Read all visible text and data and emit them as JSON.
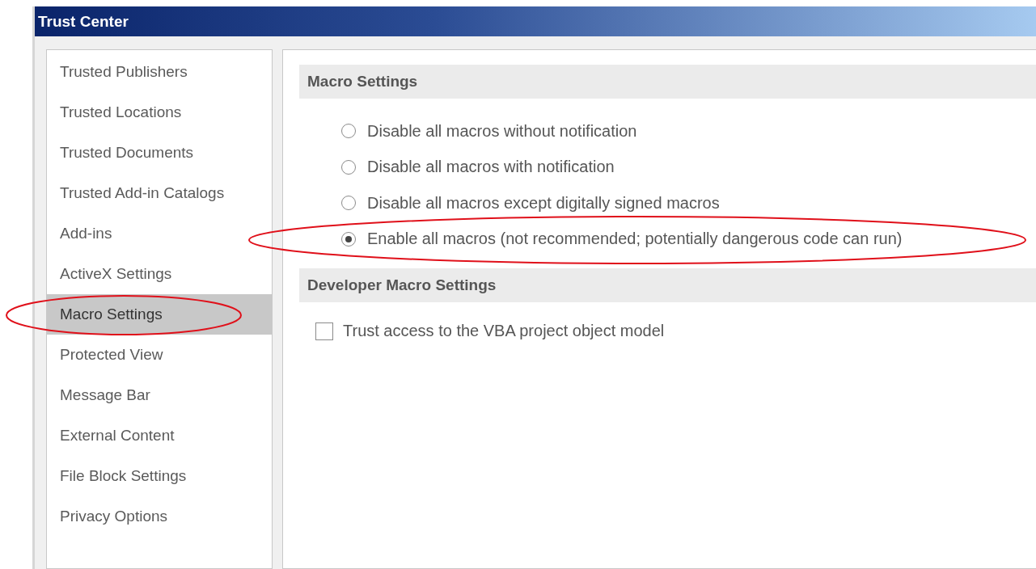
{
  "window": {
    "title": "Trust Center"
  },
  "sidebar": {
    "items": [
      {
        "label": "Trusted Publishers",
        "selected": false
      },
      {
        "label": "Trusted Locations",
        "selected": false
      },
      {
        "label": "Trusted Documents",
        "selected": false
      },
      {
        "label": "Trusted Add-in Catalogs",
        "selected": false
      },
      {
        "label": "Add-ins",
        "selected": false
      },
      {
        "label": "ActiveX Settings",
        "selected": false
      },
      {
        "label": "Macro Settings",
        "selected": true
      },
      {
        "label": "Protected View",
        "selected": false
      },
      {
        "label": "Message Bar",
        "selected": false
      },
      {
        "label": "External Content",
        "selected": false
      },
      {
        "label": "File Block Settings",
        "selected": false
      },
      {
        "label": "Privacy Options",
        "selected": false
      }
    ]
  },
  "macro_settings": {
    "heading": "Macro Settings",
    "options": [
      {
        "label": "Disable all macros without notification",
        "selected": false
      },
      {
        "label": "Disable all macros with notification",
        "selected": false
      },
      {
        "label": "Disable all macros except digitally signed macros",
        "selected": false
      },
      {
        "label": "Enable all macros (not recommended; potentially dangerous code can run)",
        "selected": true
      }
    ]
  },
  "developer_macro_settings": {
    "heading": "Developer Macro Settings",
    "options": [
      {
        "label": "Trust access to the VBA project object model",
        "checked": false
      }
    ]
  }
}
